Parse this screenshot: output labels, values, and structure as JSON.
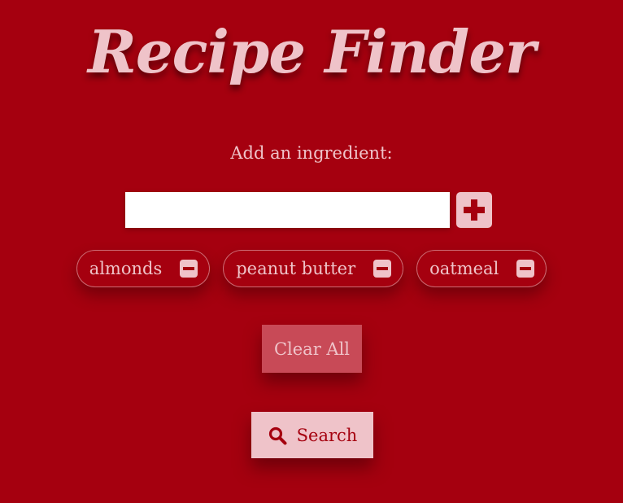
{
  "header": {
    "title": "Recipe Finder"
  },
  "form": {
    "prompt": "Add an ingredient:",
    "input_value": "",
    "input_placeholder": "",
    "add_icon": "plus-icon"
  },
  "ingredients": [
    {
      "label": "almonds",
      "remove_icon": "minus-icon"
    },
    {
      "label": "peanut butter",
      "remove_icon": "minus-icon"
    },
    {
      "label": "oatmeal",
      "remove_icon": "minus-icon"
    }
  ],
  "actions": {
    "clear_label": "Clear All",
    "search_label": "Search",
    "search_icon": "search-icon"
  },
  "colors": {
    "background": "#a5000f",
    "text_light": "#efc3c9",
    "clear_button": "#c84a57",
    "input_background": "#ffffff"
  }
}
